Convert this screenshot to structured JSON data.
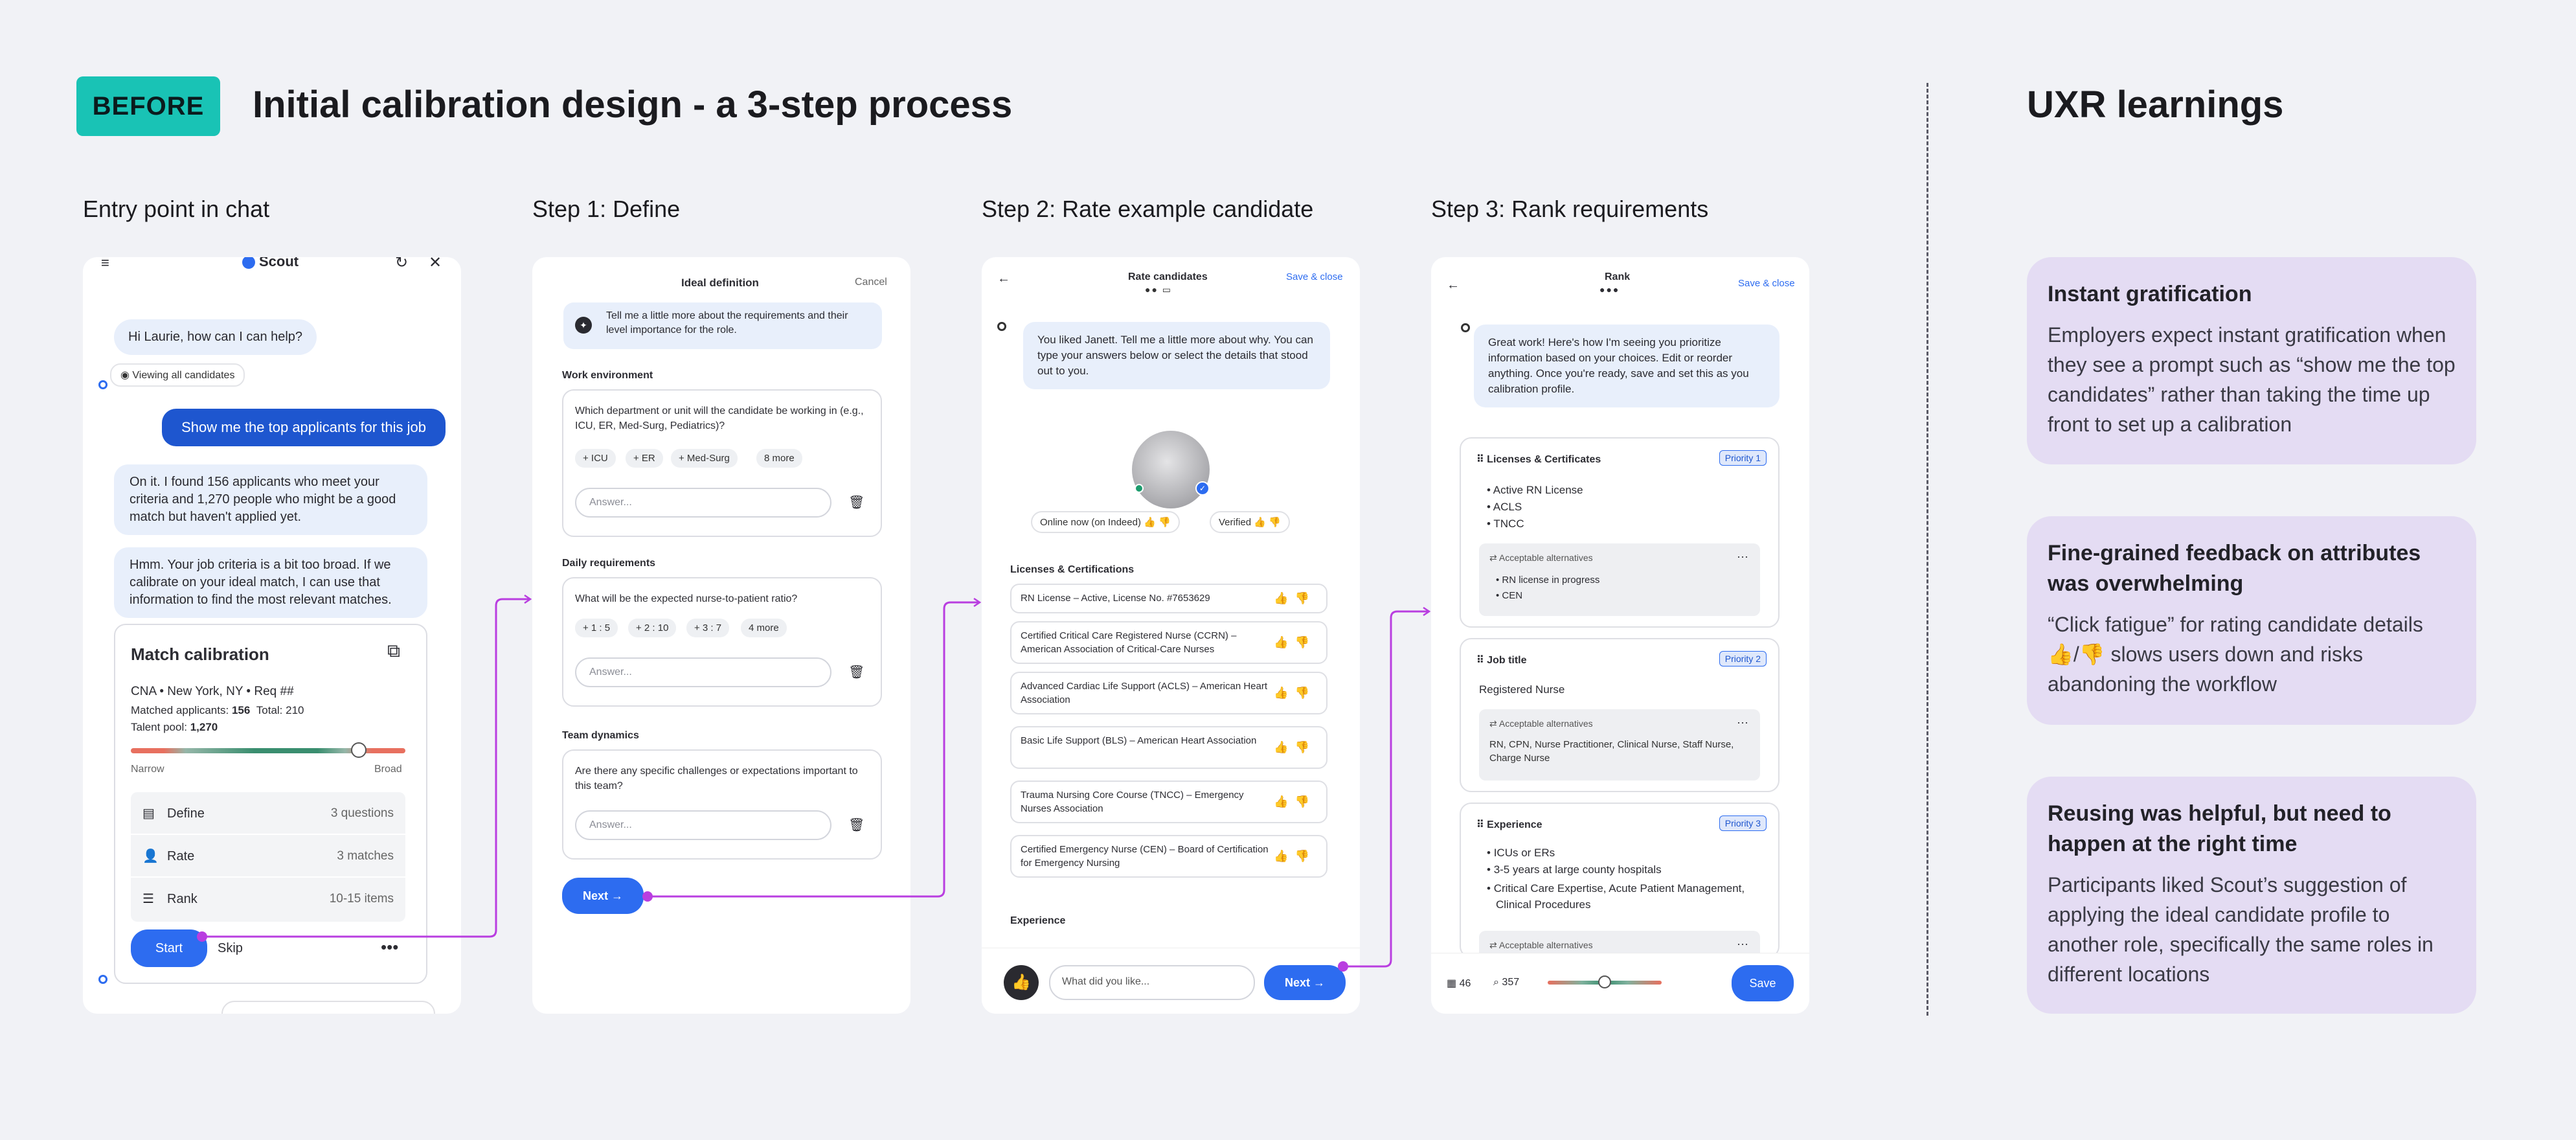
{
  "header": {
    "badge": "BEFORE",
    "title": "Initial calibration design - a 3-step process",
    "uxr_title": "UXR learnings"
  },
  "steps": [
    "Entry point in chat",
    "Step 1: Define",
    "Step 2: Rate example candidate",
    "Step 3: Rank requirements"
  ],
  "phone1": {
    "app_title": "Scout",
    "greeting": "Hi Laurie, how can I can help?",
    "viewing": "Viewing all candidates",
    "user_msg": "Show me the top applicants for this job",
    "reply1": "On it. I found 156 applicants who meet your criteria and 1,270 people who might be a good match but haven't applied yet.",
    "reply2": "Hmm. Your job criteria is a bit too broad. If we calibrate on your ideal match, I can use that information to find the most relevant matches.",
    "card_title": "Match calibration",
    "job_line": "CNA • New York, NY • Req ##",
    "matched_label": "Matched applicants:",
    "matched_value": "156",
    "total": "Total: 210",
    "pool_label": "Talent pool:",
    "pool_value": "1,270",
    "slider_value": 0.83,
    "narrow": "Narrow",
    "broad": "Broad",
    "items": [
      {
        "label": "Define",
        "detail": "3 questions"
      },
      {
        "label": "Rate",
        "detail": "3 matches"
      },
      {
        "label": "Rank",
        "detail": "10-15 items"
      }
    ],
    "start": "Start",
    "skip": "Skip"
  },
  "phone2": {
    "title": "Ideal definition",
    "cancel": "Cancel",
    "intro": "Tell me a little more about the requirements and their level importance for the role.",
    "sections": [
      {
        "heading": "Work environment",
        "question": "Which department or unit will the candidate be working in (e.g., ICU, ER, Med-Surg, Pediatrics)?",
        "chips": [
          "+ ICU",
          "+ ER",
          "+ Med-Surg",
          "8 more"
        ]
      },
      {
        "heading": "Daily requirements",
        "question": "What will be the expected nurse-to-patient ratio?",
        "chips": [
          "+ 1 : 5",
          "+ 2 : 10",
          "+ 3 : 7",
          "4 more"
        ]
      },
      {
        "heading": "Team dynamics",
        "question": "Are there any specific challenges or expectations important to this team?",
        "chips": []
      }
    ],
    "answer_placeholder": "Answer...",
    "next": "Next →"
  },
  "phone3": {
    "title": "Rate candidates",
    "save_close": "Save & close",
    "message": "You liked Janett. Tell me a little more about why. You can type your answers below or select the details that stood out to you.",
    "online": "Online now (on Indeed)",
    "verified": "Verified",
    "section": "Licenses & Certifications",
    "certs": [
      "RN License – Active, License No. #7653629",
      "Certified Critical Care Registered Nurse (CCRN) – American Association of Critical-Care Nurses",
      "Advanced Cardiac Life Support (ACLS) – American Heart Association",
      "Basic Life Support (BLS) – American Heart Association",
      "Trauma Nursing Core Course (TNCC) – Emergency Nurses Association",
      "Certified Emergency Nurse (CEN) – Board of Certification for Emergency Nursing"
    ],
    "experience": "Experience",
    "input_placeholder": "What did you like...",
    "next": "Next →"
  },
  "phone4": {
    "title": "Rank",
    "save_close": "Save & close",
    "message": "Great work! Here's how I'm seeing you prioritize information based on your choices. Edit or reorder anything. Once you're ready, save and set this as you calibration profile.",
    "acceptable": "Acceptable alternatives",
    "cards": [
      {
        "title": "Licenses & Certificates",
        "priority": "Priority 1",
        "items": [
          "Active RN License",
          "ACLS",
          "TNCC"
        ],
        "alts": [
          "RN license in progress",
          "CEN"
        ]
      },
      {
        "title": "Job title",
        "priority": "Priority 2",
        "value": "Registered Nurse",
        "alts_text": "RN, CPN, Nurse Practitioner, Clinical Nurse, Staff Nurse, Charge Nurse"
      },
      {
        "title": "Experience",
        "priority": "Priority 3",
        "items": [
          "ICUs or ERs",
          "3-5 years at large county hospitals",
          "Critical Care Expertise, Acute Patient Management, Clinical Procedures"
        ]
      }
    ],
    "count1": "46",
    "count2": "357",
    "slider_value": 0.5,
    "save": "Save"
  },
  "learnings": [
    {
      "heading": "Instant gratification",
      "body": "Employers expect instant gratification when they see a prompt such as  “show me the top candidates” rather than taking the time up front to set up a calibration"
    },
    {
      "heading": "Fine-grained feedback on attributes  was overwhelming",
      "body": "“Click fatigue” for rating candidate details 👍/👎 slows users down and risks abandoning the workflow"
    },
    {
      "heading": "Reusing was helpful, but need to happen at the right time",
      "body": "Participants liked Scout’s suggestion of applying the ideal candidate profile to another role, specifically the same roles in different locations"
    }
  ],
  "colors": {
    "badge": "#19c3b5",
    "brand_blue": "#2d6cf0",
    "connector": "#b93ee0",
    "learning_card": "#e4dcf3"
  }
}
